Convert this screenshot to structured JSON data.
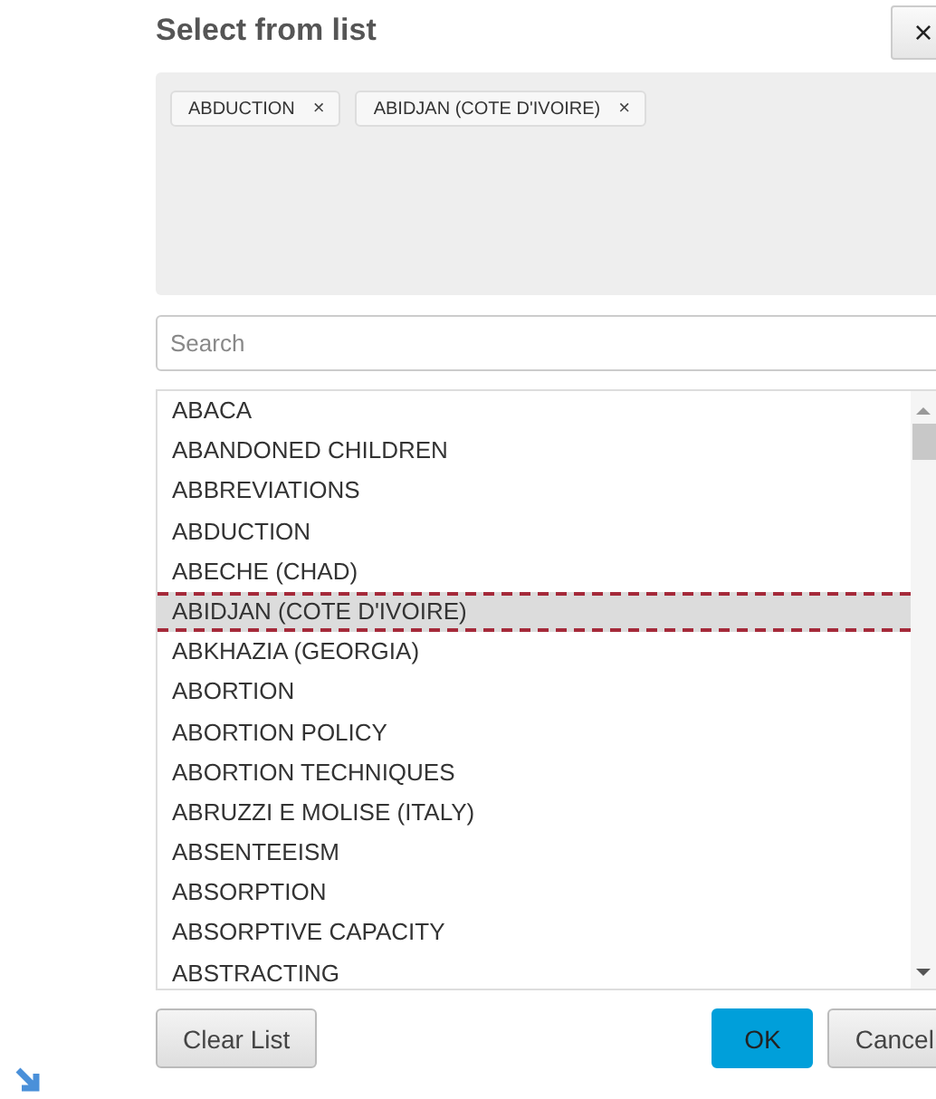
{
  "dialog": {
    "title": "Select from list",
    "close": "×"
  },
  "tags": [
    {
      "label": "ABDUCTION",
      "remove": "×"
    },
    {
      "label": "ABIDJAN (COTE D'IVOIRE)",
      "remove": "×"
    }
  ],
  "search": {
    "placeholder": "Search"
  },
  "list": [
    {
      "label": "ABACA",
      "selected": false
    },
    {
      "label": "ABANDONED CHILDREN",
      "selected": false
    },
    {
      "label": "ABBREVIATIONS",
      "selected": false
    },
    {
      "label": "ABDUCTION",
      "selected": false
    },
    {
      "label": "ABECHE (CHAD)",
      "selected": false
    },
    {
      "label": "ABIDJAN (COTE D'IVOIRE)",
      "selected": true
    },
    {
      "label": "ABKHAZIA (GEORGIA)",
      "selected": false
    },
    {
      "label": "ABORTION",
      "selected": false
    },
    {
      "label": "ABORTION POLICY",
      "selected": false
    },
    {
      "label": "ABORTION TECHNIQUES",
      "selected": false
    },
    {
      "label": "ABRUZZI E MOLISE (ITALY)",
      "selected": false
    },
    {
      "label": "ABSENTEEISM",
      "selected": false
    },
    {
      "label": "ABSORPTION",
      "selected": false
    },
    {
      "label": "ABSORPTIVE CAPACITY",
      "selected": false
    },
    {
      "label": "ABSTRACTING",
      "selected": false
    }
  ],
  "buttons": [
    {
      "label": "Clear List",
      "kind": "secondary"
    },
    {
      "label": "OK",
      "kind": "primary"
    },
    {
      "label": "Cancel",
      "kind": "secondary"
    }
  ]
}
